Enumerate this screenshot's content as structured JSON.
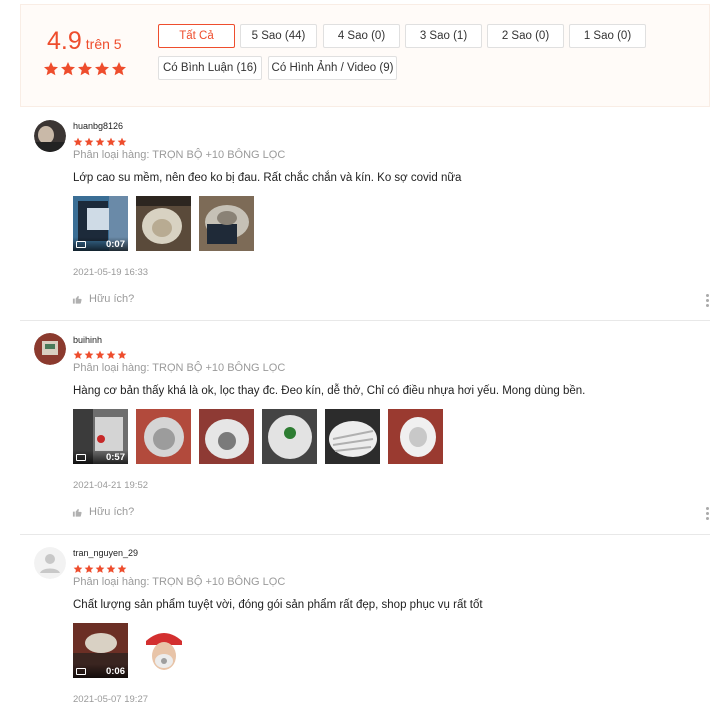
{
  "summary": {
    "score": "4.9",
    "out_of": "trên 5",
    "filters": [
      {
        "label": "Tất Cả",
        "active": true
      },
      {
        "label": "5 Sao (44)"
      },
      {
        "label": "4 Sao (0)"
      },
      {
        "label": "3 Sao (1)"
      },
      {
        "label": "2 Sao (0)"
      },
      {
        "label": "1 Sao (0)"
      },
      {
        "label": "Có Bình Luận (16)"
      },
      {
        "label": "Có Hình Ảnh / Video (9)"
      }
    ],
    "star_color": "#ee4d2d"
  },
  "reviews": [
    {
      "username": "huanbg8126",
      "rating": 5,
      "variant": "Phân loại hàng: TRỌN BỘ +10 BÔNG LỌC",
      "comment": "Lớp cao su mềm, nên đeo ko bị đau. Rất chắc chắn và kín. Ko sợ covid nữa",
      "video_duration": "0:07",
      "timestamp": "2021-05-19 16:33",
      "helpful": "Hữu ích?"
    },
    {
      "username": "buihinh",
      "rating": 5,
      "variant": "Phân loại hàng: TRỌN BỘ +10 BÔNG LỌC",
      "comment": "Hàng cơ bản thấy khá là ok, lọc thay đc. Đeo kín, dễ thở,  Chỉ có điều nhựa hơi yếu. Mong dùng bền.",
      "video_duration": "0:57",
      "timestamp": "2021-04-21 19:52",
      "helpful": "Hữu ích?"
    },
    {
      "username": "tran_nguyen_29",
      "rating": 5,
      "variant": "Phân loại hàng: TRỌN BỘ +10 BÔNG LỌC",
      "comment": "Chất lượng sản phẩm tuyệt vời, đóng gói sản phẩm rất đẹp, shop phục vụ rất tốt",
      "video_duration": "0:06",
      "timestamp": "2021-05-07 19:27"
    }
  ]
}
